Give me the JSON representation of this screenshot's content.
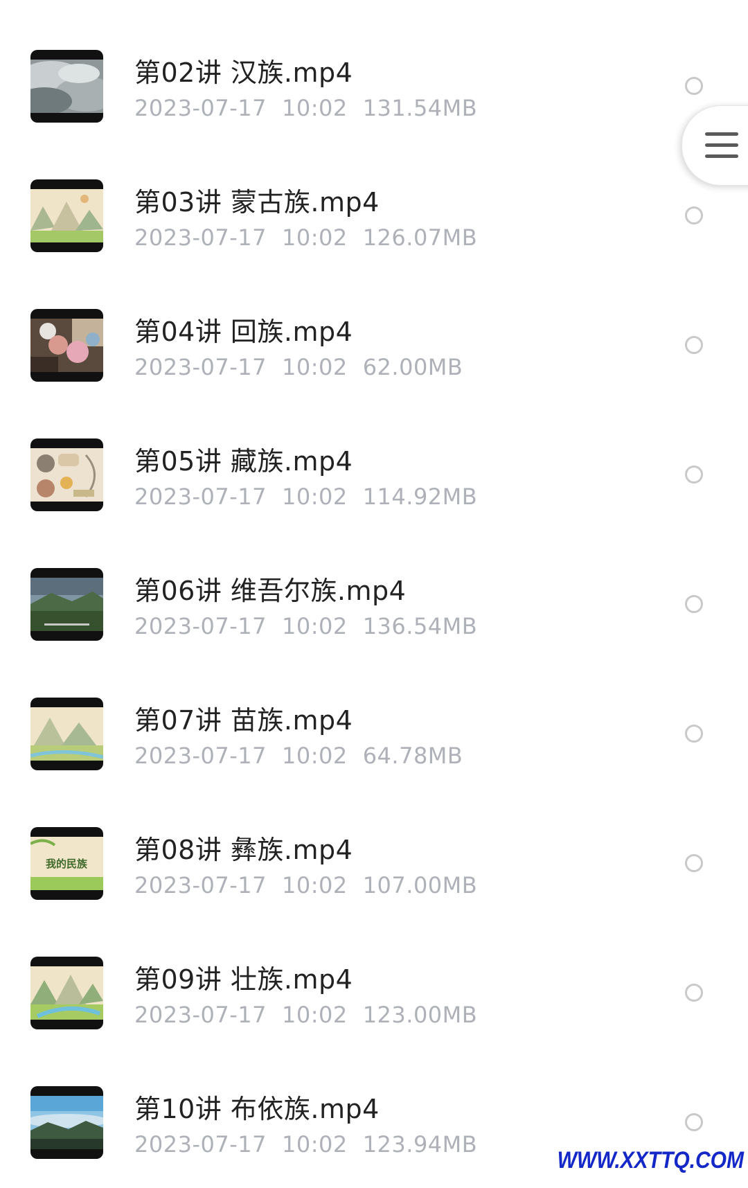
{
  "files": [
    {
      "title": "第02讲 汉族.mp4",
      "date": "2023-07-17",
      "time": "10:02",
      "size": "131.54MB",
      "thumb_icon": "misty-mountain-thumbnail"
    },
    {
      "title": "第03讲 蒙古族.mp4",
      "date": "2023-07-17",
      "time": "10:02",
      "size": "126.07MB",
      "thumb_icon": "cartoon-landscape-thumbnail"
    },
    {
      "title": "第04讲 回族.mp4",
      "date": "2023-07-17",
      "time": "10:02",
      "size": "62.00MB",
      "thumb_icon": "people-photo-thumbnail"
    },
    {
      "title": "第05讲 藏族.mp4",
      "date": "2023-07-17",
      "time": "10:02",
      "size": "114.92MB",
      "thumb_icon": "cartoon-collage-thumbnail"
    },
    {
      "title": "第06讲 维吾尔族.mp4",
      "date": "2023-07-17",
      "time": "10:02",
      "size": "136.54MB",
      "thumb_icon": "valley-landscape-thumbnail"
    },
    {
      "title": "第07讲 苗族.mp4",
      "date": "2023-07-17",
      "time": "10:02",
      "size": "64.78MB",
      "thumb_icon": "cartoon-landscape-thumbnail"
    },
    {
      "title": "第08讲 彝族.mp4",
      "date": "2023-07-17",
      "time": "10:02",
      "size": "107.00MB",
      "thumb_icon": "title-card-thumbnail",
      "thumb_text": "我的民族"
    },
    {
      "title": "第09讲 壮族.mp4",
      "date": "2023-07-17",
      "time": "10:02",
      "size": "123.00MB",
      "thumb_icon": "cartoon-landscape-thumbnail"
    },
    {
      "title": "第10讲 布依族.mp4",
      "date": "2023-07-17",
      "time": "10:02",
      "size": "123.94MB",
      "thumb_icon": "misty-forest-thumbnail"
    }
  ],
  "floating_menu": {
    "icon": "hamburger-menu-icon"
  },
  "watermark": "WWW.XXTTQ.COM",
  "colors": {
    "title": "#222222",
    "meta": "#aeb1b8",
    "radio_border": "#c9c9c9",
    "watermark": "#1428c8"
  }
}
